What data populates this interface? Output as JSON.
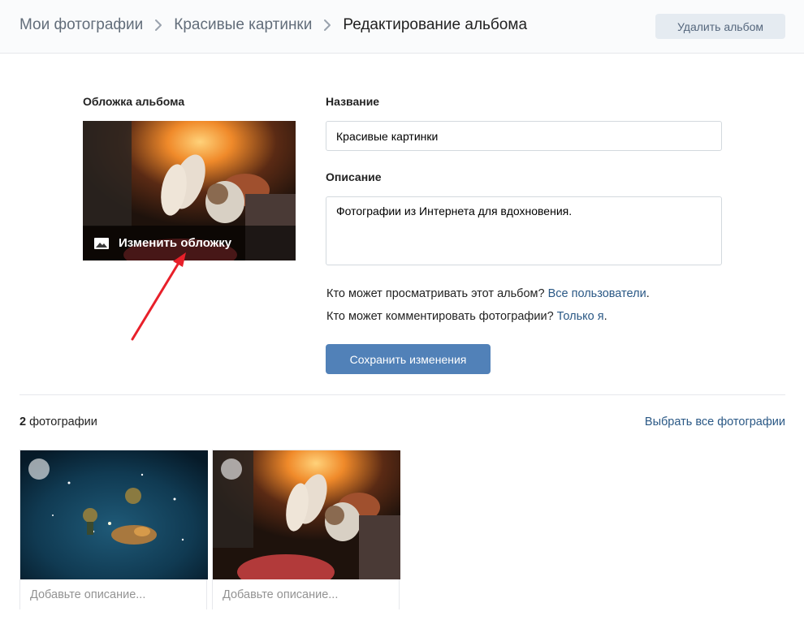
{
  "breadcrumbs": {
    "items": [
      "Мои фотографии",
      "Красивые картинки"
    ],
    "current": "Редактирование альбома"
  },
  "header": {
    "delete_label": "Удалить альбом"
  },
  "cover": {
    "label": "Обложка альбома",
    "change_label": "Изменить обложку"
  },
  "name": {
    "label": "Название",
    "value": "Красивые картинки"
  },
  "description": {
    "label": "Описание",
    "value": "Фотографии из Интернета для вдохновения."
  },
  "privacy": {
    "view_question": "Кто может просматривать этот альбом?",
    "view_value": "Все пользователи",
    "comment_question": "Кто может комментировать фотографии?",
    "comment_value": "Только я"
  },
  "save_label": "Сохранить изменения",
  "photos": {
    "count": "2",
    "count_label": "фотографии",
    "select_all": "Выбрать все фотографии",
    "items": [
      {
        "desc_placeholder": "Добавьте описание..."
      },
      {
        "desc_placeholder": "Добавьте описание..."
      }
    ]
  },
  "colors": {
    "accent": "#5181b8",
    "link": "#2a5885",
    "annotation_arrow": "#e8202a"
  }
}
